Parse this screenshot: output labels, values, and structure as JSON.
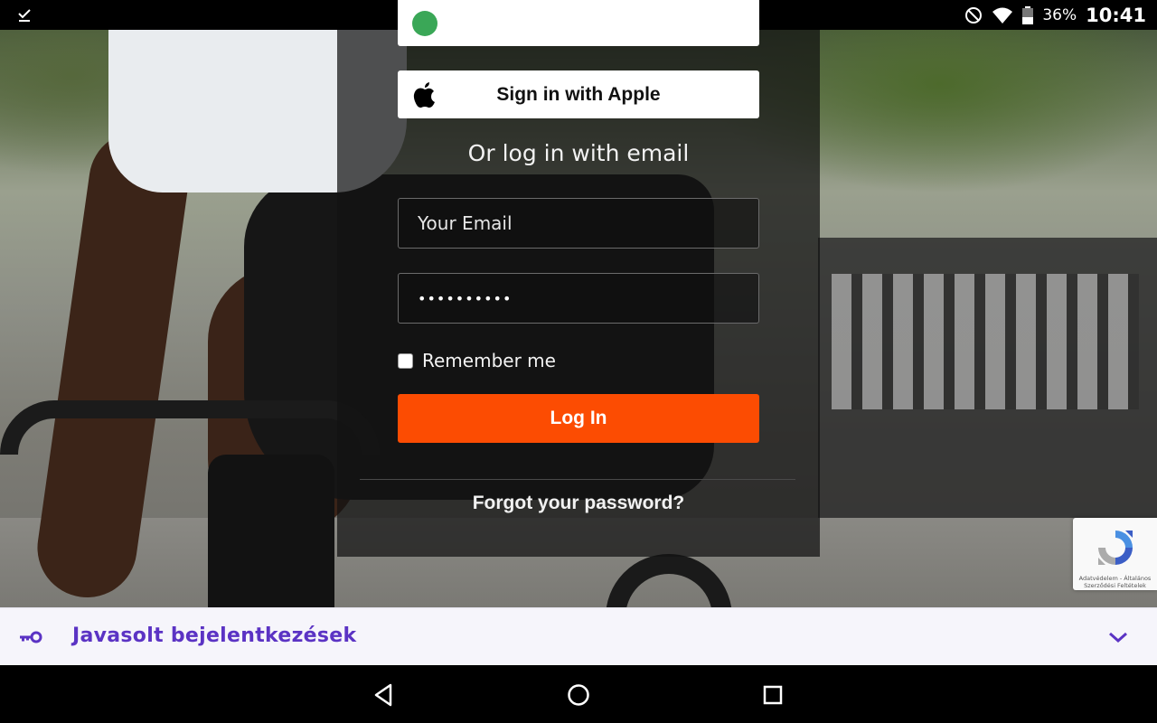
{
  "status_bar": {
    "battery_percent": "36%",
    "time": "10:41",
    "icons": [
      "download-done-icon",
      "do-not-disturb-icon",
      "wifi-icon",
      "battery-icon"
    ]
  },
  "login": {
    "apple_button_label": "Sign in with Apple",
    "or_text": "Or log in with email",
    "email_placeholder": "Your Email",
    "password_value": "••••••••••",
    "remember_label": "Remember me",
    "login_button_label": "Log In",
    "forgot_link": "Forgot your password?"
  },
  "recaptcha": {
    "links": "Adatvédelem - Általános Szerződési Feltételek"
  },
  "suggest_bar": {
    "label": "Javasolt bejelentkezések"
  },
  "colors": {
    "accent": "#fc4c02",
    "suggest_text": "#5b33c4"
  }
}
